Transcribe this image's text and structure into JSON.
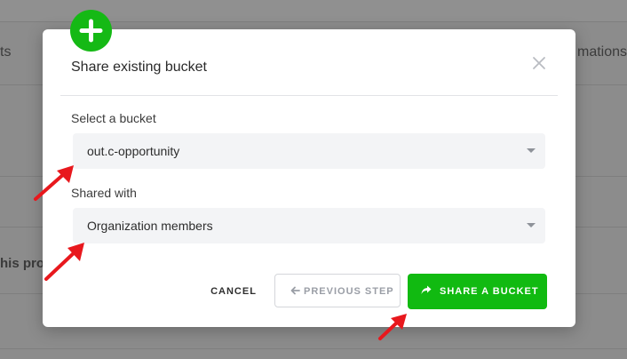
{
  "background": {
    "left_text": "ts",
    "right_text": "mations",
    "section_text": "his proj"
  },
  "modal": {
    "title": "Share existing bucket",
    "close_label": "×",
    "bucket_field": {
      "label": "Select a bucket",
      "value": "out.c-opportunity"
    },
    "shared_with_field": {
      "label": "Shared with",
      "value": "Organization members"
    },
    "buttons": {
      "cancel": "CANCEL",
      "previous": "PREVIOUS STEP",
      "share": "SHARE A BUCKET"
    }
  },
  "colors": {
    "accent_green": "#11ba11",
    "arrow_red": "#e8181d"
  },
  "icons": [
    "plus-icon",
    "close-icon",
    "chevron-down-icon",
    "arrow-left-icon",
    "share-icon",
    "annotation-arrow-icon"
  ]
}
